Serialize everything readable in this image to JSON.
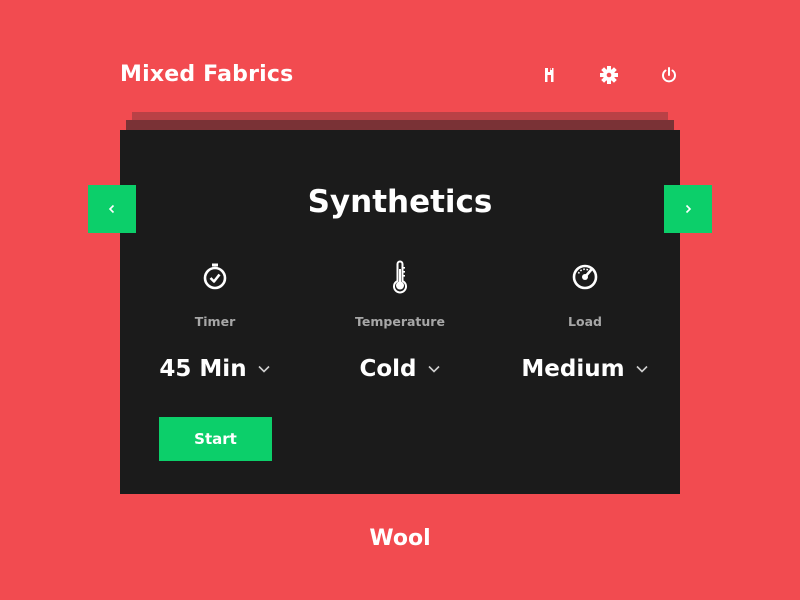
{
  "app": {
    "title": "Mixed Fabrics",
    "header_icons": [
      "plug-icon",
      "gear-icon",
      "power-icon"
    ]
  },
  "program": {
    "current": "Synthetics",
    "next": "Wool"
  },
  "settings": [
    {
      "label": "Timer",
      "value": "45 Min",
      "icon": "timer-icon"
    },
    {
      "label": "Temperature",
      "value": "Cold",
      "icon": "thermometer-icon"
    },
    {
      "label": "Load",
      "value": "Medium",
      "icon": "gauge-icon"
    }
  ],
  "actions": {
    "start_label": "Start"
  },
  "colors": {
    "background": "#f24b50",
    "card": "#1b1b1b",
    "accent": "#0ccf6a",
    "label": "#a7a7a7"
  }
}
